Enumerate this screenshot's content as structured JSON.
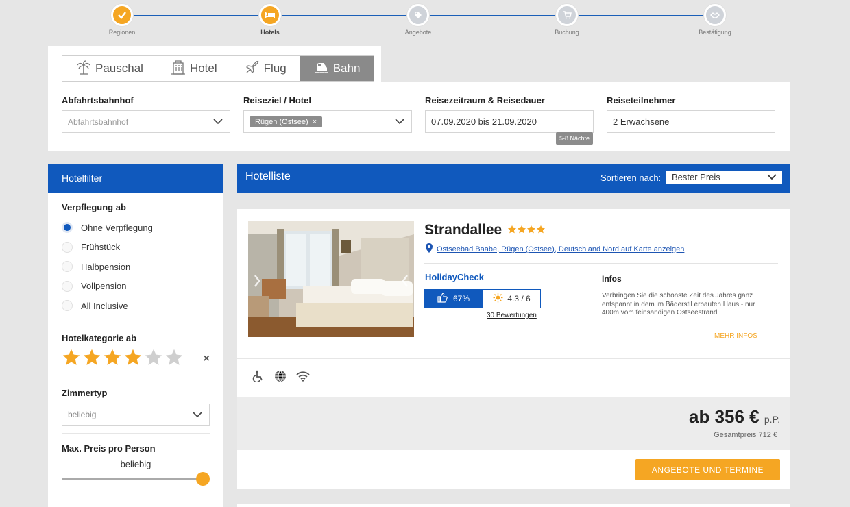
{
  "steps": [
    {
      "label": "Regionen",
      "state": "done",
      "icon": "check-icon"
    },
    {
      "label": "Hotels",
      "state": "active",
      "icon": "bed-icon"
    },
    {
      "label": "Angebote",
      "state": "todo",
      "icon": "tag-icon"
    },
    {
      "label": "Buchung",
      "state": "todo",
      "icon": "cart-icon"
    },
    {
      "label": "Bestätigung",
      "state": "todo",
      "icon": "handshake-icon"
    }
  ],
  "tabs": [
    {
      "label": "Pauschal",
      "icon": "palm-icon"
    },
    {
      "label": "Hotel",
      "icon": "building-icon"
    },
    {
      "label": "Flug",
      "icon": "plane-icon"
    },
    {
      "label": "Bahn",
      "icon": "train-icon",
      "active": true
    }
  ],
  "search": {
    "departure": {
      "label": "Abfahrtsbahnhof",
      "placeholder": "Abfahrtsbahnhof"
    },
    "destination": {
      "label": "Reiseziel / Hotel",
      "chip": "Rügen (Ostsee)",
      "chip_remove": "×"
    },
    "dates": {
      "label": "Reisezeitraum & Reisedauer",
      "value": "07.09.2020 bis 21.09.2020",
      "nights": "5-8 Nächte"
    },
    "travelers": {
      "label": "Reiseteilnehmer",
      "value": "2 Erwachsene"
    }
  },
  "filter": {
    "title": "Hotelfilter",
    "board_title": "Verpflegung ab",
    "board_options": [
      "Ohne Verpflegung",
      "Frühstück",
      "Halbpension",
      "Vollpension",
      "All Inclusive"
    ],
    "board_selected": 0,
    "category_title": "Hotelkategorie ab",
    "category_rating": 4,
    "category_max": 6,
    "clear": "×",
    "room_title": "Zimmertyp",
    "room_value": "beliebig",
    "price_title": "Max. Preis pro Person",
    "price_value": "beliebig"
  },
  "list": {
    "title": "Hotelliste",
    "sort_label": "Sortieren nach:",
    "sort_value": "Bester Preis"
  },
  "hotel": {
    "name": "Strandallee",
    "stars": 4,
    "location": "Ostseebad Baabe, Rügen (Ostsee), Deutschland Nord auf Karte anzeigen",
    "rating_brand": "HolidayCheck",
    "recommend": "67%",
    "score": "4.3 / 6",
    "reviews": "30 Bewertungen",
    "infos_title": "Infos",
    "infos_text": "Verbringen Sie die schönste Zeit des Jahres ganz entspannt in dem im Bäderstil erbauten Haus - nur 400m vom feinsandigen Ostseestrand",
    "more": "MEHR INFOS",
    "amenities": [
      "wheelchair-icon",
      "globe-icon",
      "wifi-icon"
    ],
    "price_prefix": "ab 356 €",
    "price_suffix": "p.P.",
    "total": "Gesamtpreis 712 €",
    "cta": "ANGEBOTE UND TERMINE"
  },
  "colors": {
    "brand_blue": "#1059bd",
    "accent_orange": "#f5a623"
  }
}
